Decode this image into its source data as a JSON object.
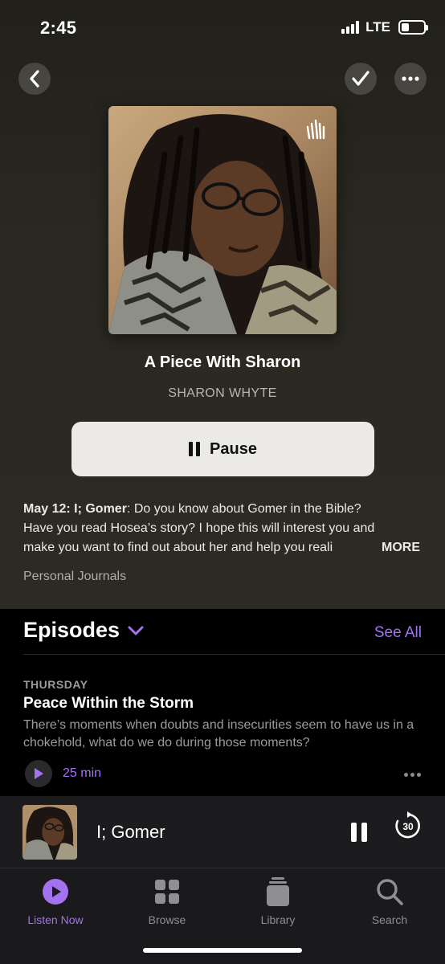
{
  "status_bar": {
    "time": "2:45",
    "network": "LTE"
  },
  "show": {
    "title": "A Piece With Sharon",
    "author": "SHARON WHYTE",
    "pause_label": "Pause",
    "description_bold": "May 12: I; Gomer",
    "description_line1_rest": ": Do you know about Gomer in the Bible?",
    "description_line2": "Have you read Hosea’s story? I hope this will interest you and",
    "description_line3": "make you want to find out about her and help you reali",
    "more_label": "MORE",
    "genre": "Personal Journals"
  },
  "episodes": {
    "heading": "Episodes",
    "see_all": "See All",
    "items": [
      {
        "day": "THURSDAY",
        "title": "Peace Within the Storm",
        "description": "There’s moments when doubts and insecurities seem to have us in a chokehold, what do we do during those moments?",
        "duration": "25 min"
      }
    ]
  },
  "mini_player": {
    "title": "I; Gomer",
    "skip_seconds": "30"
  },
  "tab_bar": {
    "tabs": [
      {
        "label": "Listen Now",
        "icon": "play-circle-icon",
        "active": true
      },
      {
        "label": "Browse",
        "icon": "grid-icon",
        "active": false
      },
      {
        "label": "Library",
        "icon": "stack-icon",
        "active": false
      },
      {
        "label": "Search",
        "icon": "search-icon",
        "active": false
      }
    ]
  },
  "colors": {
    "accent": "#a471f0",
    "hero_bg": "#2a2820",
    "pause_button_bg": "#ebeae6"
  }
}
